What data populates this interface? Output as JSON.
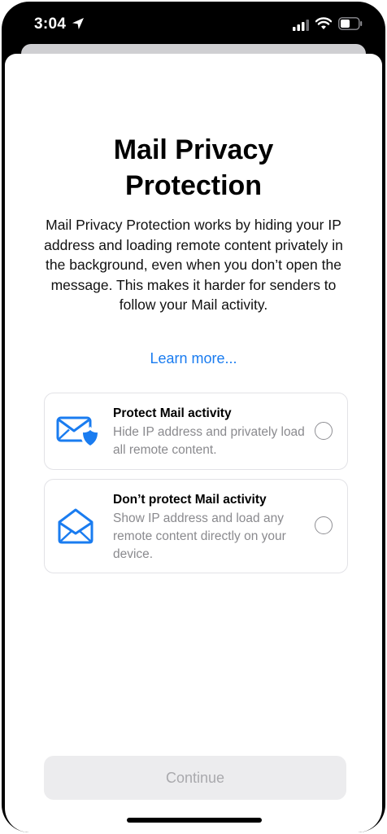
{
  "status_bar": {
    "time": "3:04",
    "icons": [
      "location-arrow-icon",
      "cellular-signal-icon",
      "wifi-icon",
      "battery-icon"
    ]
  },
  "sheet": {
    "title_line1": "Mail Privacy",
    "title_line2": "Protection",
    "description": "Mail Privacy Protection works by hiding your IP address and loading remote content privately in the background, even when you don’t open the message. This makes it harder for senders to follow your Mail activity.",
    "learn_more": "Learn more..."
  },
  "options": [
    {
      "title": "Protect Mail activity",
      "description": "Hide IP address and privately load all remote content.",
      "icon": "envelope-shield-icon",
      "selected": false
    },
    {
      "title": "Don’t protect Mail activity",
      "description": "Show IP address and load any remote content directly on your device.",
      "icon": "open-envelope-icon",
      "selected": false
    }
  ],
  "continue_label": "Continue",
  "colors": {
    "accent": "#1a7cf0",
    "disabled_text": "#a9a9ad",
    "secondary_text": "#8a8a8e"
  }
}
